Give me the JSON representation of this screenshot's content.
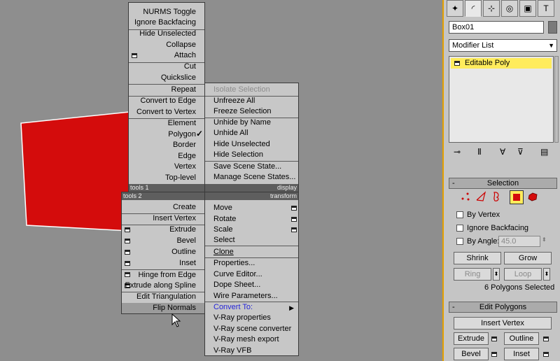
{
  "colors": {
    "box_front": "#d40c0c",
    "highlight": "#ffec5c",
    "accent_border": "#e4a000"
  },
  "cursor_icon": "arrow-pointer-icon",
  "quad_top_left": {
    "items": [
      "NURMS Toggle",
      "Ignore Backfacing",
      "Hide Unselected",
      "Collapse",
      "Attach",
      "Cut",
      "Quickslice",
      "Repeat",
      "Convert to Edge",
      "Convert to Vertex",
      "Element",
      "Polygon",
      "Border",
      "Edge",
      "Vertex",
      "Top-level"
    ],
    "title": "tools 1"
  },
  "quad_top_right": {
    "items": [
      "Isolate Selection",
      "Unfreeze All",
      "Freeze Selection",
      "Unhide by Name",
      "Unhide All",
      "Hide Unselected",
      "Hide Selection",
      "Save Scene State...",
      "Manage Scene States..."
    ],
    "title": "display"
  },
  "quad_bottom_left": {
    "title": "tools 2",
    "items": [
      "Create",
      "Insert Vertex",
      "Extrude",
      "Bevel",
      "Outline",
      "Inset",
      "Hinge from Edge",
      "Extrude along Spline",
      "Edit Triangulation",
      "Flip Normals"
    ]
  },
  "quad_bottom_right": {
    "title": "transform",
    "items": [
      "Move",
      "Rotate",
      "Scale",
      "Select",
      "Clone",
      "Properties...",
      "Curve Editor...",
      "Dope Sheet...",
      "Wire Parameters...",
      "Convert To:",
      "V-Ray properties",
      "V-Ray scene converter",
      "V-Ray mesh export",
      "V-Ray VFB"
    ]
  },
  "panel": {
    "object_name": "Box01",
    "modifier_list": "Modifier List",
    "modifier": "Editable Poly",
    "selection": {
      "title": "Selection",
      "by_vertex": "By Vertex",
      "ignore_backfacing": "Ignore Backfacing",
      "by_angle": "By Angle:",
      "angle_value": "45.0",
      "shrink": "Shrink",
      "grow": "Grow",
      "ring": "Ring",
      "loop": "Loop",
      "status": "6 Polygons Selected"
    },
    "edit_polygons": {
      "title": "Edit Polygons",
      "insert_vertex": "Insert Vertex",
      "extrude": "Extrude",
      "outline": "Outline",
      "bevel": "Bevel",
      "inset": "Inset"
    }
  }
}
